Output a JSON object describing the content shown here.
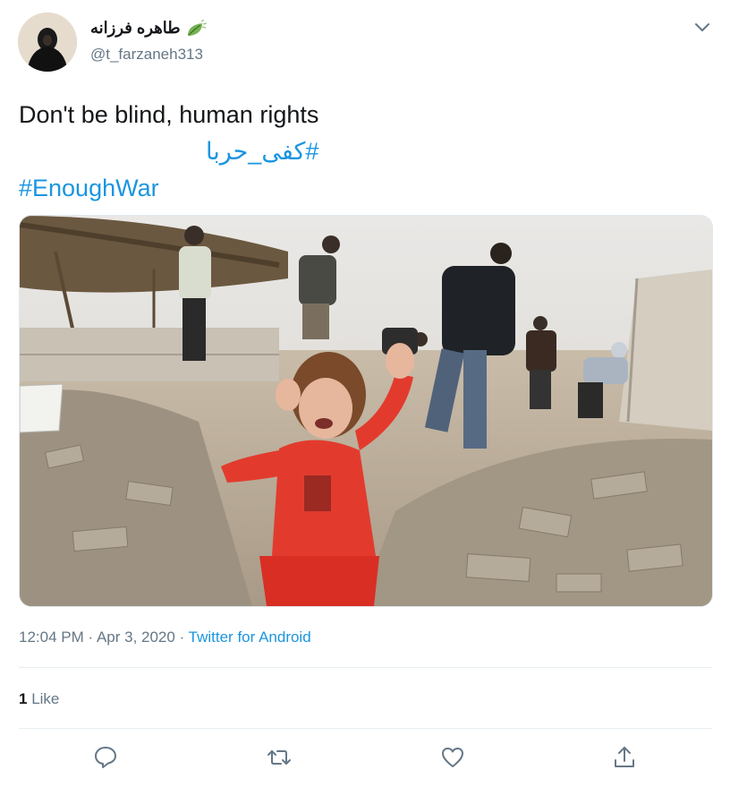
{
  "author": {
    "display_name": "طاهره فرزانه",
    "handle": "@t_farzaneh313",
    "avatar_icon": "avatar-woman-chador",
    "name_emoji_icon": "leaf-flutter-icon"
  },
  "tweet": {
    "text": "Don't be blind, human rights",
    "hashtags": [
      "#کفی_حربا",
      "#EnoughWar"
    ]
  },
  "media": {
    "alt_icon": "photo-crying-child-rubble"
  },
  "meta": {
    "time": "12:04 PM",
    "separator": " · ",
    "date": "Apr 3, 2020",
    "separator2": " · ",
    "source": "Twitter for Android"
  },
  "stats": {
    "like_count": "1",
    "like_label": " Like"
  },
  "actions": {
    "reply_icon": "reply-icon",
    "retweet_icon": "retweet-icon",
    "like_icon": "heart-icon",
    "share_icon": "share-icon"
  },
  "colors": {
    "accent": "#1b95e0",
    "text": "#14171a",
    "secondary": "#657786",
    "divider": "#e6ecf0"
  }
}
